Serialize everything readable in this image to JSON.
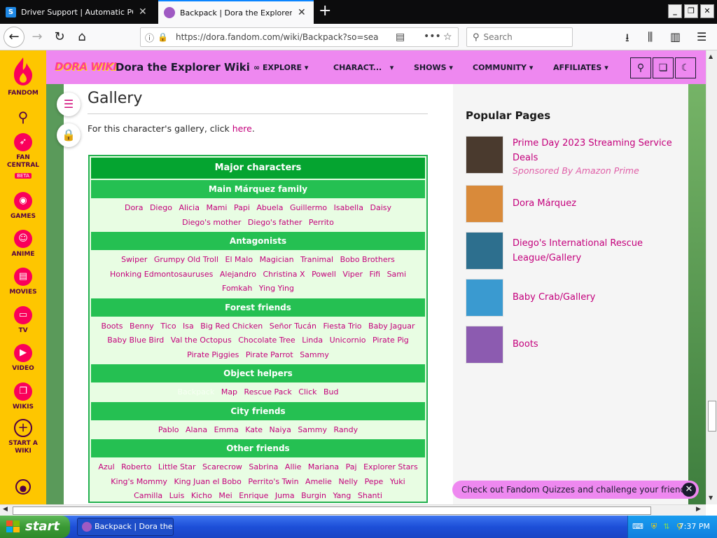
{
  "browser": {
    "tabs": [
      {
        "title": "Driver Support | Automatic PC Mai",
        "favicon_text": "S",
        "active": false
      },
      {
        "title": "Backpack | Dora the Explorer Wiki",
        "active": true
      }
    ],
    "new_tab_icon": "plus-icon",
    "url": "https://dora.fandom.com/wiki/Backpack?so=sea",
    "search_placeholder": "Search"
  },
  "fandom_rail": {
    "items": [
      {
        "label": "FANDOM",
        "icon": "fandom-flame-icon"
      },
      {
        "label": "",
        "icon": "search-icon"
      },
      {
        "label": "FAN CENTRAL",
        "badge": "BETA",
        "icon": "rocket-icon"
      },
      {
        "label": "GAMES",
        "icon": "gamepad-icon"
      },
      {
        "label": "ANIME",
        "icon": "anime-icon"
      },
      {
        "label": "MOVIES",
        "icon": "movies-icon"
      },
      {
        "label": "TV",
        "icon": "tv-icon"
      },
      {
        "label": "VIDEO",
        "icon": "video-icon"
      },
      {
        "label": "WIKIS",
        "icon": "book-icon"
      },
      {
        "label": "START A WIKI",
        "icon": "plus-circle-icon"
      },
      {
        "label": "",
        "icon": "user-icon"
      }
    ]
  },
  "wiki_header": {
    "logo_text": "DORA WIKI",
    "site_name": "Dora the Explorer Wiki",
    "nav": [
      {
        "label": "EXPLORE",
        "icon": "explore-icon"
      },
      {
        "label": "CHARACT...",
        "icon": ""
      },
      {
        "label": "SHOWS",
        "icon": ""
      },
      {
        "label": "COMMUNITY",
        "icon": ""
      },
      {
        "label": "AFFILIATES",
        "icon": ""
      }
    ]
  },
  "article": {
    "section_title": "Gallery",
    "gallery_text": "For this character's gallery, click ",
    "gallery_link": "here",
    "gallery_text_end": "."
  },
  "navbox": {
    "title": "Major characters",
    "groups": [
      {
        "title": "Main Márquez family",
        "links": [
          "Dora",
          "Diego",
          "Alicia",
          "Mami",
          "Papi",
          "Abuela",
          "Guillermo",
          "Isabella",
          "Daisy",
          "Diego's mother",
          "Diego's father",
          "Perrito"
        ]
      },
      {
        "title": "Antagonists",
        "links": [
          "Swiper",
          "Grumpy Old Troll",
          "El Malo",
          "Magician",
          "Tranimal",
          "Bobo Brothers",
          "Honking Edmontosauruses",
          "Alejandro",
          "Christina X",
          "Powell",
          "Viper",
          "Fifi",
          "Sami",
          "Fomkah",
          "Ying Ying"
        ]
      },
      {
        "title": "Forest friends",
        "links": [
          "Boots",
          "Benny",
          "Tico",
          "Isa",
          "Big Red Chicken",
          "Señor Tucán",
          "Fiesta Trio",
          "Baby Jaguar",
          "Baby Blue Bird",
          "Val the Octopus",
          "Chocolate Tree",
          "Linda",
          "Unicornio",
          "Pirate Pig",
          "Pirate Piggies",
          "Pirate Parrot",
          "Sammy"
        ]
      },
      {
        "title": "Object helpers",
        "links": [
          "Backpack",
          "Map",
          "Rescue Pack",
          "Click",
          "Bud"
        ],
        "current": "Backpack"
      },
      {
        "title": "City friends",
        "links": [
          "Pablo",
          "Alana",
          "Emma",
          "Kate",
          "Naiya",
          "Sammy",
          "Randy"
        ]
      },
      {
        "title": "Other friends",
        "links": [
          "Azul",
          "Roberto",
          "Little Star",
          "Scarecrow",
          "Sabrina",
          "Allie",
          "Mariana",
          "Paj",
          "Explorer Stars",
          "King's Mommy",
          "King Juan el Bobo",
          "Perrito's Twin",
          "Amelie",
          "Nelly",
          "Pepe",
          "Yuki",
          "Camilla",
          "Luis",
          "Kicho",
          "Mei",
          "Enrique",
          "Juma",
          "Burgin",
          "Yang",
          "Shanti"
        ]
      }
    ]
  },
  "popular_pages": {
    "title": "Popular Pages",
    "items": [
      {
        "name": "Prime Day 2023 Streaming Service Deals",
        "sponsor": "Sponsored By Amazon Prime",
        "thumb_color": "#4a3a2e"
      },
      {
        "name": "Dora Márquez",
        "thumb_color": "#d98a3a"
      },
      {
        "name": "Diego's International Rescue League/Gallery",
        "thumb_color": "#2d6f8e"
      },
      {
        "name": "Baby Crab/Gallery",
        "thumb_color": "#3a9ad0"
      },
      {
        "name": "Boots",
        "thumb_color": "#8c5bb0"
      }
    ]
  },
  "quiz_banner": {
    "text": "Check out Fandom Quizzes and challenge your friends!"
  },
  "taskbar": {
    "start_label": "start",
    "task_label": "Backpack | Dora the ...",
    "clock": "7:37 PM"
  }
}
